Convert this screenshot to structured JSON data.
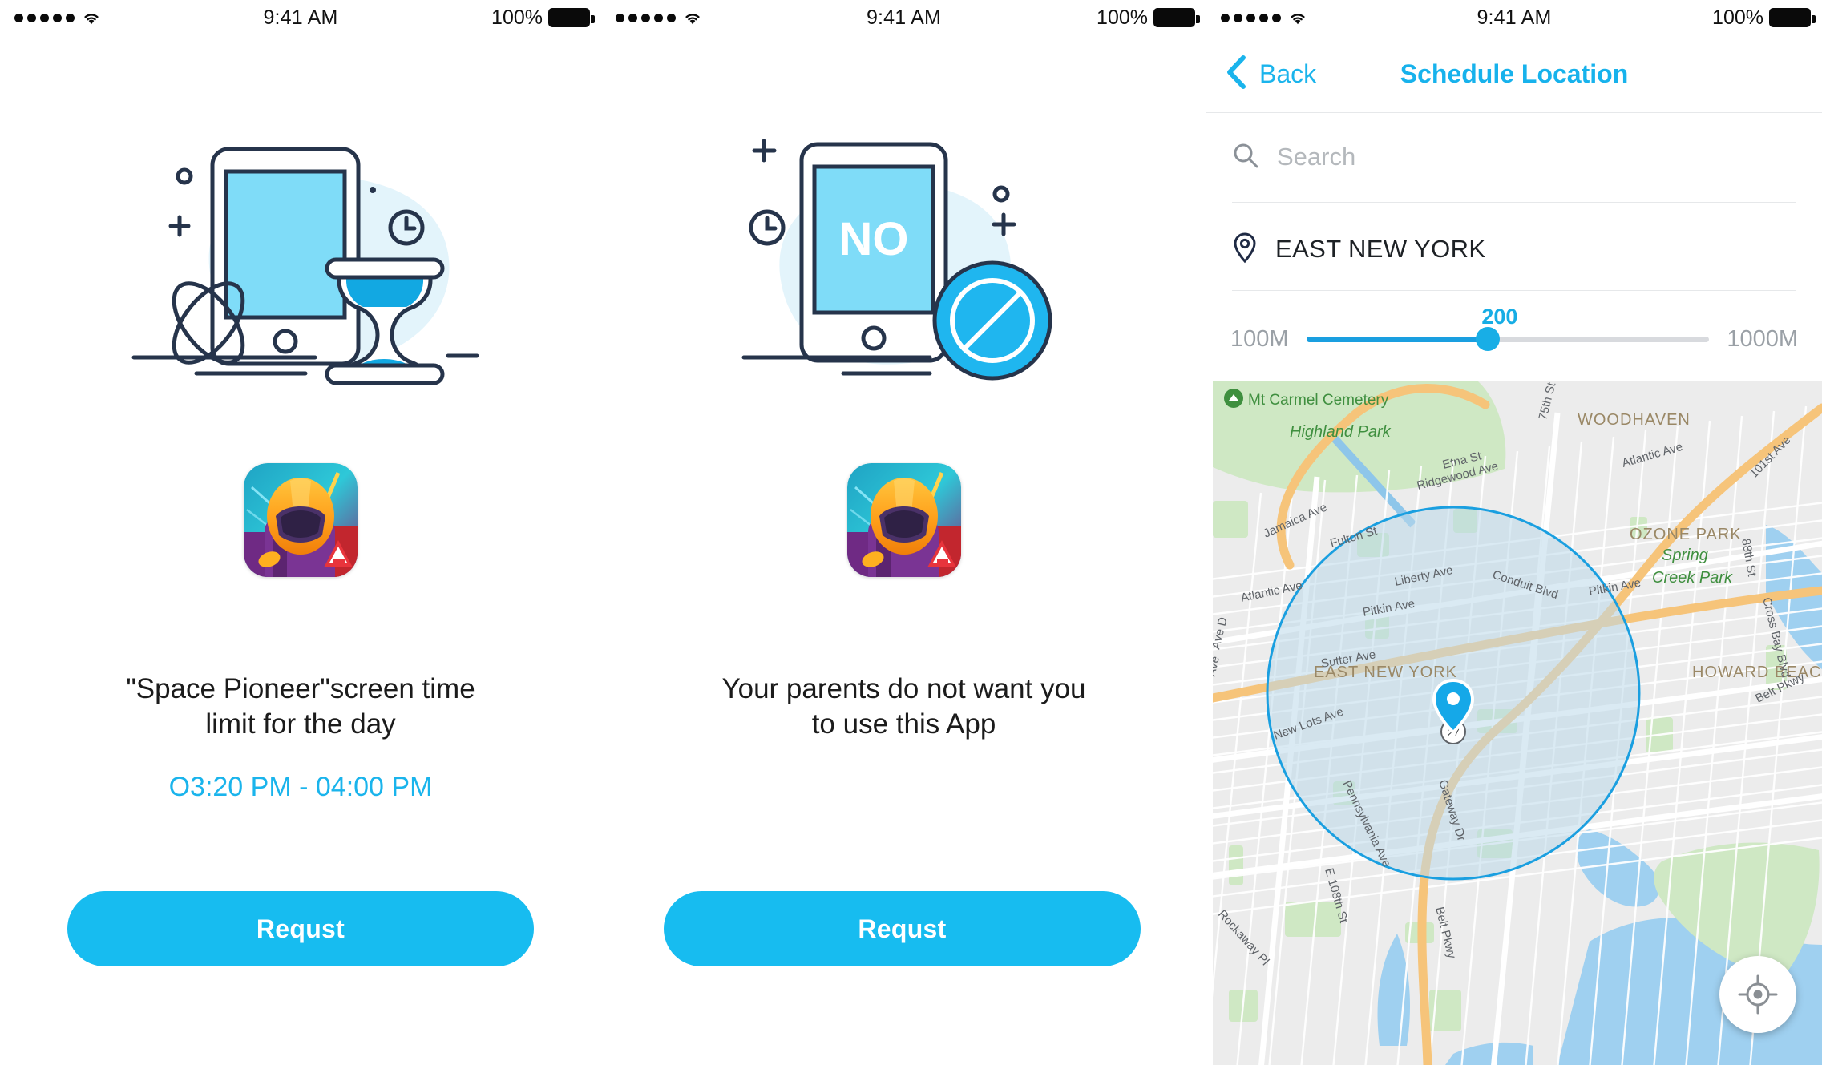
{
  "status_bar": {
    "signal_icon": "signal-dots-icon",
    "wifi_icon": "wifi-icon",
    "time": "9:41 AM",
    "battery_percent": "100%",
    "battery_icon": "battery-full-icon"
  },
  "theme": {
    "accent": "#17bcf0",
    "accent_dark": "#1a9fe0",
    "text": "#1b1b1b",
    "muted": "#9aa0a6",
    "illustration_outline": "#26344b",
    "illustration_fill": "#7fdcf8",
    "illustration_blob": "#e3f4fb"
  },
  "screen_time_limit": {
    "illustration": {
      "name": "phone-hourglass-illustration",
      "phone_icon": "tablet-icon",
      "hourglass_icon": "hourglass-icon",
      "clock_icon": "clock-icon",
      "atom_icon": "atom-icon",
      "plus_icon": "plus-icon",
      "circle_icon": "small-circle-icon"
    },
    "app_icon": {
      "name": "space-pioneer-app-icon",
      "badge_text": "A"
    },
    "message": "\"Space Pioneer\"screen time limit for the day",
    "message_line1": "\"Space Pioneer\"screen time",
    "message_line2": "limit for the day",
    "time_range": "O3:20 PM - 04:00 PM",
    "request_button": "Requst"
  },
  "blocked_app": {
    "illustration": {
      "name": "phone-blocked-illustration",
      "phone_icon": "tablet-icon",
      "phone_screen_text": "NO",
      "block_icon": "prohibited-sign-icon",
      "clock_icon": "clock-icon",
      "plus_icon": "plus-icon",
      "circle_icon": "small-circle-icon"
    },
    "app_icon": {
      "name": "space-pioneer-app-icon",
      "badge_text": "A"
    },
    "message_line1": "Your parents do not want you",
    "message_line2": "to use this App",
    "request_button": "Requst"
  },
  "schedule_location": {
    "nav": {
      "back_icon": "chevron-left-icon",
      "back_label": "Back",
      "title": "Schedule Location"
    },
    "search": {
      "icon": "search-icon",
      "placeholder": "Search",
      "value": ""
    },
    "location": {
      "icon": "map-pin-icon",
      "label": "EAST NEW YORK"
    },
    "radius_slider": {
      "min_label": "100M",
      "max_label": "1000M",
      "value_label": "200",
      "value": 200,
      "min": 100,
      "max": 1000,
      "fill_percent": 45
    },
    "map": {
      "my_location_button_icon": "crosshair-icon",
      "marker_icon": "map-marker-icon",
      "highlight_circle_color": "#1a9fe0",
      "route_shield": "27",
      "neighborhood_labels": [
        "WOODHAVEN",
        "OZONE PARK",
        "EAST NEW YORK",
        "HOWARD BEAC"
      ],
      "park_labels": [
        "Mt Carmel Cemetery",
        "Highland Park",
        "Spring Creek Park"
      ],
      "street_labels": [
        "75th St",
        "Etna St",
        "Ridgewood Ave",
        "Atlantic Ave",
        "101st Ave",
        "Jamaica Ave",
        "Fulton St",
        "Atlantic Ave",
        "Liberty Ave",
        "Conduit Blvd",
        "Pitkin Ave",
        "Pitkin Ave",
        "Sutter Ave",
        "Cross Bay Blvd",
        "New Lots Ave",
        "Gateway Dr",
        "Pennsylvania Ave",
        "E 108th St",
        "Rockaway Pl",
        "Belt Pkwy",
        "Belt Pkwy",
        "88th St",
        "Ave D",
        "Ave"
      ]
    }
  }
}
